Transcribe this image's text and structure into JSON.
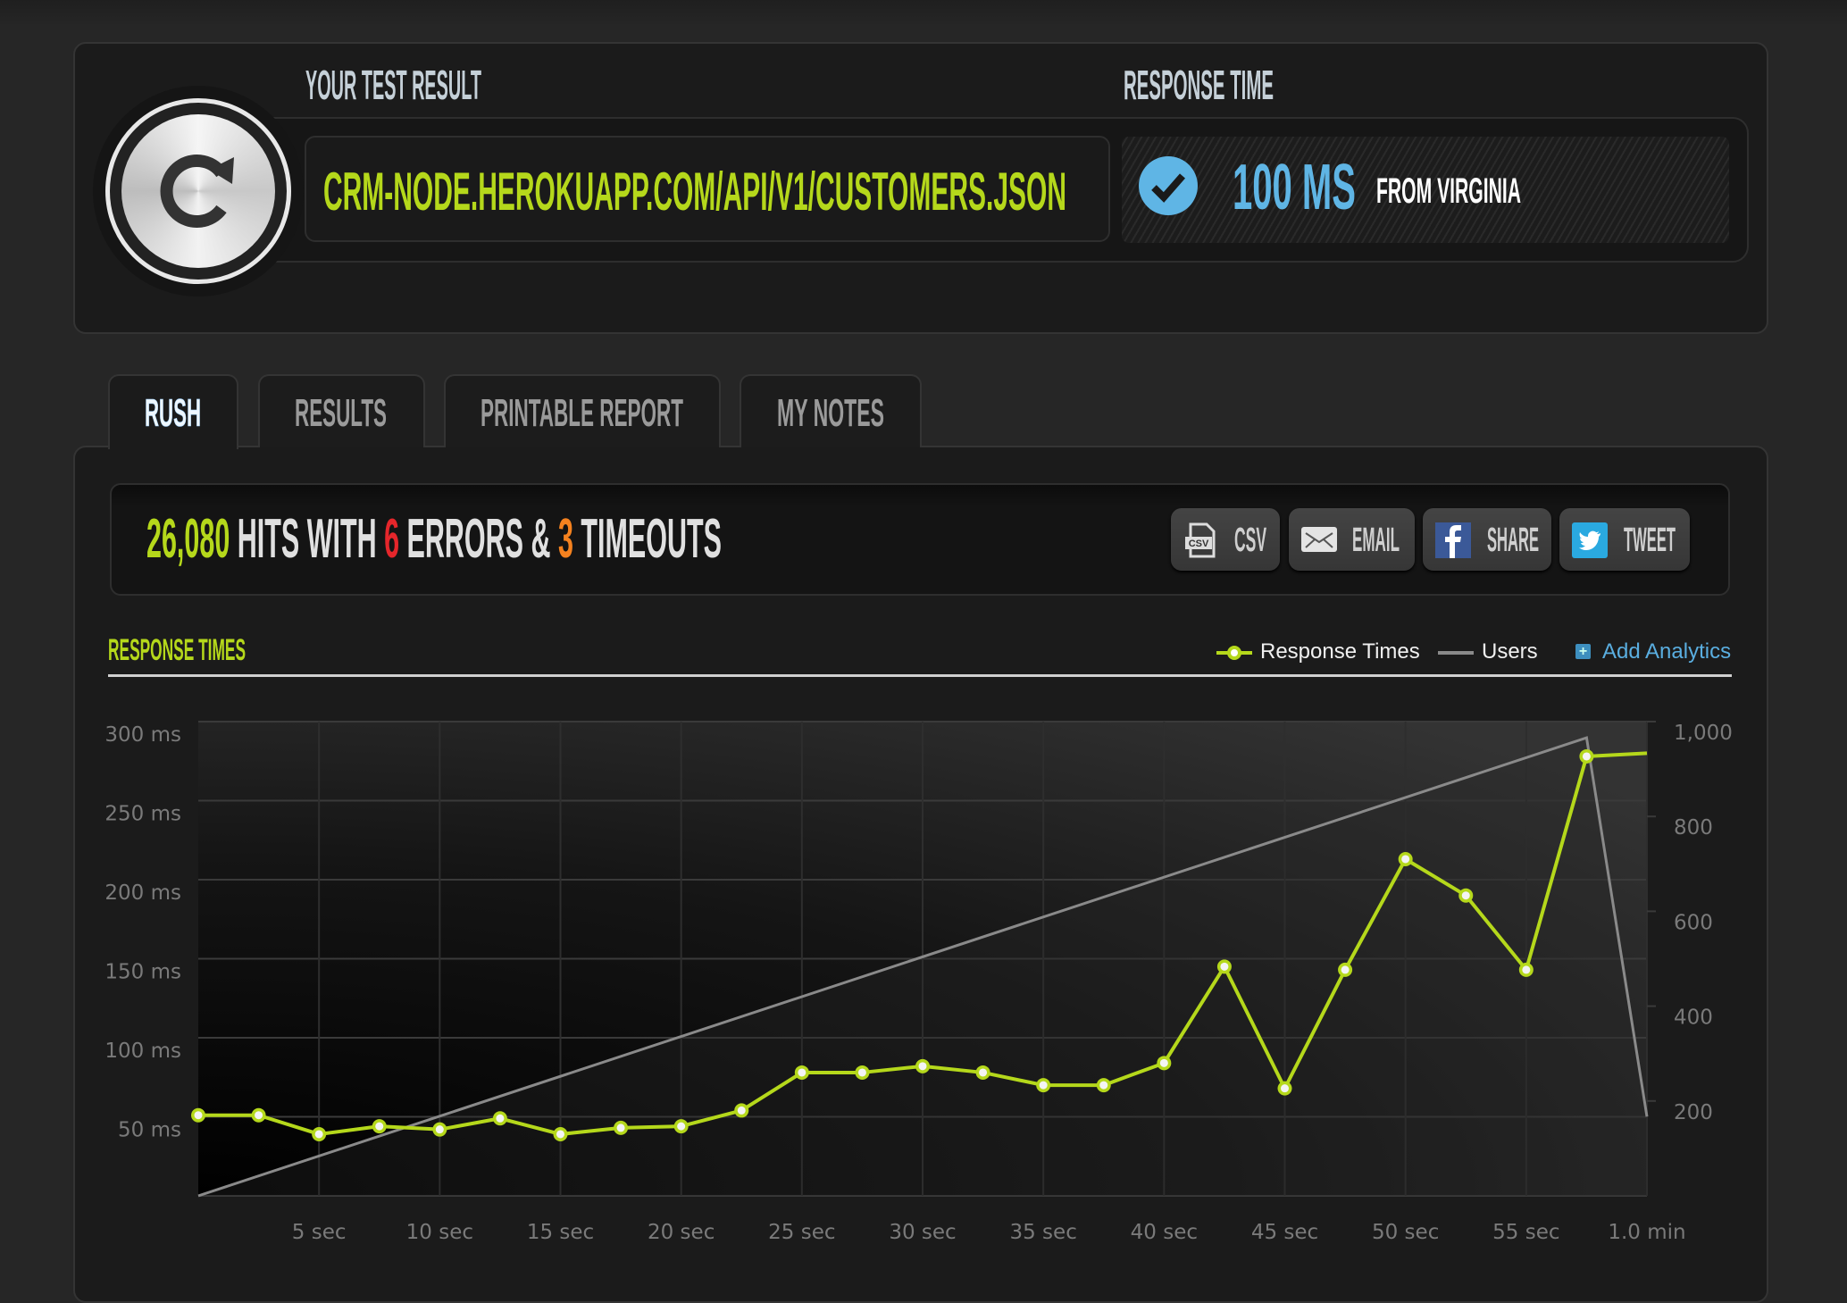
{
  "header": {
    "test_result_label": "YOUR TEST RESULT",
    "url": "CRM-NODE.HEROKUAPP.COM/API/V1/CUSTOMERS.JSON",
    "response_time_label": "RESPONSE TIME",
    "response_time_value": "100 MS",
    "response_location": "FROM VIRGINIA",
    "status_icon": "check-circle-icon",
    "logo_icon": "refresh-icon"
  },
  "tabs": [
    {
      "label": "RUSH",
      "active": true
    },
    {
      "label": "RESULTS",
      "active": false
    },
    {
      "label": "PRINTABLE REPORT",
      "active": false
    },
    {
      "label": "MY NOTES",
      "active": false
    }
  ],
  "summary": {
    "hits": "26,080",
    "hits_with": " HITS WITH ",
    "errors": "6",
    "errors_label": " ERRORS & ",
    "timeouts": "3",
    "timeouts_label": " TIMEOUTS"
  },
  "actions": [
    {
      "label": "CSV",
      "icon": "csv-file-icon"
    },
    {
      "label": "EMAIL",
      "icon": "envelope-icon"
    },
    {
      "label": "SHARE",
      "icon": "facebook-icon"
    },
    {
      "label": "TWEET",
      "icon": "twitter-icon"
    }
  ],
  "colors": {
    "accent_green": "#b5d81b",
    "accent_blue": "#5fb5e5",
    "errors_red": "#e5262b",
    "timeouts_orange": "#f5821f",
    "users_line": "#8a8a8a",
    "facebook": "#3b5998",
    "twitter": "#2aa9e0"
  },
  "chart_section": {
    "title": "RESPONSE TIMES",
    "legend": [
      "Response Times",
      "Users"
    ],
    "add_analytics": "Add Analytics"
  },
  "chart_data": {
    "type": "line",
    "x_unit": "sec",
    "xlim": [
      0,
      60
    ],
    "x_ticks": [
      5,
      10,
      15,
      20,
      25,
      30,
      35,
      40,
      45,
      50,
      55,
      60
    ],
    "x_tick_labels": [
      "5 sec",
      "10 sec",
      "15 sec",
      "20 sec",
      "25 sec",
      "30 sec",
      "35 sec",
      "40 sec",
      "45 sec",
      "50 sec",
      "55 sec",
      "1.0 min"
    ],
    "y_left": {
      "range": [
        0,
        300
      ],
      "ticks": [
        50,
        100,
        150,
        200,
        250,
        300
      ],
      "tick_labels": [
        "50 ms",
        "100 ms",
        "150 ms",
        "200 ms",
        "250 ms",
        "300 ms"
      ]
    },
    "y_right": {
      "range": [
        0,
        1000
      ],
      "ticks": [
        200,
        400,
        600,
        800,
        1000
      ],
      "tick_labels": [
        "200",
        "400",
        "600",
        "800",
        "1,000"
      ]
    },
    "grid": true,
    "legend_placement": "top-right",
    "series": [
      {
        "name": "Response Times",
        "axis": "left",
        "color": "#b5d81b",
        "x": [
          0,
          2.5,
          5,
          7.5,
          10,
          12.5,
          15,
          17.5,
          20,
          22.5,
          25,
          27.5,
          30,
          32.5,
          35,
          37.5,
          40,
          42.5,
          45,
          47.5,
          50,
          52.5,
          55,
          57.5,
          60
        ],
        "values": [
          51,
          51,
          39,
          44,
          42,
          49,
          39,
          43,
          44,
          54,
          78,
          78,
          82,
          78,
          70,
          70,
          84,
          145,
          68,
          143,
          213,
          190,
          143,
          278,
          280
        ]
      },
      {
        "name": "Users",
        "axis": "right",
        "color": "#8a8a8a",
        "x": [
          0,
          57.5,
          60
        ],
        "values": [
          0,
          966,
          167
        ]
      }
    ]
  }
}
